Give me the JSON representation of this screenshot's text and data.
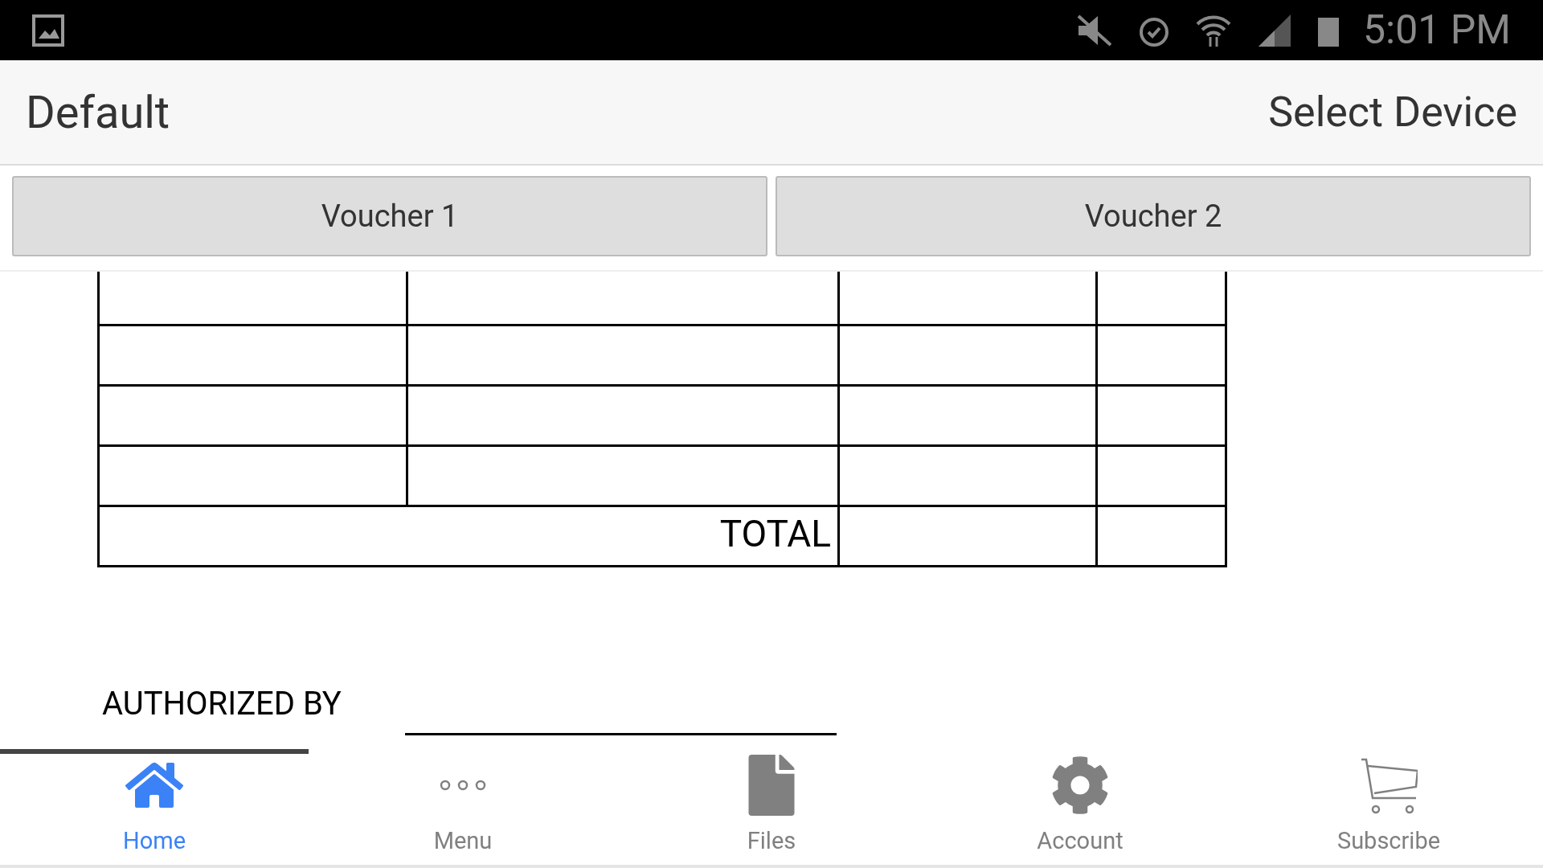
{
  "status_bar": {
    "time": "5:01 PM"
  },
  "header": {
    "title": "Default",
    "action": "Select Device"
  },
  "tabs": [
    {
      "label": "Voucher 1",
      "selected": false
    },
    {
      "label": "Voucher 2",
      "selected": false
    }
  ],
  "table": {
    "total_label": "TOTAL"
  },
  "signature": {
    "label": "AUTHORIZED BY"
  },
  "nav": [
    {
      "kind": "home",
      "label": "Home",
      "selected": true
    },
    {
      "kind": "menu",
      "label": "Menu",
      "selected": false
    },
    {
      "kind": "files",
      "label": "Files",
      "selected": false
    },
    {
      "kind": "account",
      "label": "Account",
      "selected": false
    },
    {
      "kind": "subscribe",
      "label": "Subscribe",
      "selected": false
    }
  ]
}
